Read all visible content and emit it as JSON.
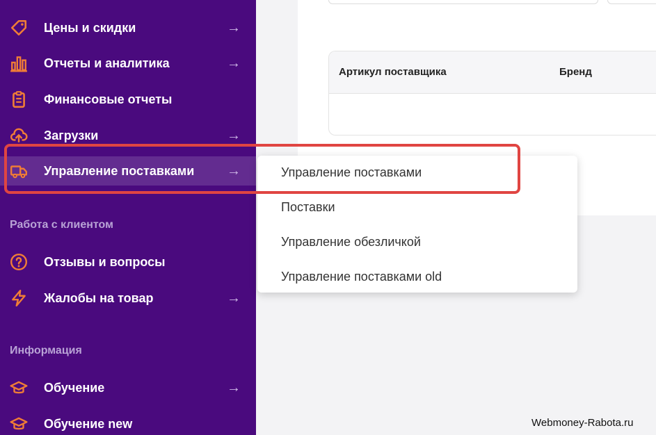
{
  "sidebar": {
    "items": [
      {
        "label": "Цены и скидки",
        "icon": "price-tag-icon",
        "arrow": "→"
      },
      {
        "label": "Отчеты и аналитика",
        "icon": "bar-chart-icon",
        "arrow": "→"
      },
      {
        "label": "Финансовые отчеты",
        "icon": "clipboard-icon",
        "arrow": ""
      },
      {
        "label": "Загрузки",
        "icon": "cloud-upload-icon",
        "arrow": "→"
      },
      {
        "label": "Управление поставками",
        "icon": "truck-icon",
        "arrow": "→"
      }
    ],
    "section_client": "Работа с клиентом",
    "client_items": [
      {
        "label": "Отзывы и вопросы",
        "icon": "question-circle-icon",
        "arrow": ""
      },
      {
        "label": "Жалобы на товар",
        "icon": "lightning-icon",
        "arrow": "→"
      }
    ],
    "section_info": "Информация",
    "info_items": [
      {
        "label": "Обучение",
        "icon": "graduation-cap-icon",
        "arrow": "→"
      },
      {
        "label": "Обучение new",
        "icon": "graduation-cap-icon",
        "arrow": ""
      }
    ]
  },
  "table": {
    "columns": [
      "Артикул поставщика",
      "Бренд"
    ]
  },
  "dropdown": {
    "items": [
      "Управление поставками",
      "Поставки",
      "Управление обезличкой",
      "Управление поставками old"
    ]
  },
  "watermark": "Webmoney-Rabota.ru",
  "colors": {
    "sidebar_bg": "#4a0a7e",
    "accent_orange": "#f07d36",
    "highlight_border": "#e04542"
  }
}
